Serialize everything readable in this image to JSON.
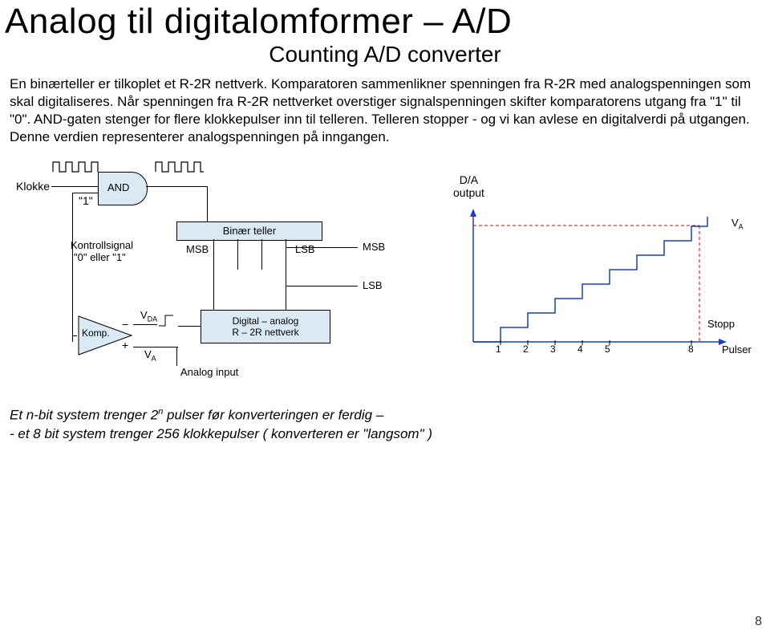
{
  "title": "Analog til digitalomformer – A/D",
  "subtitle": "Counting A/D converter",
  "paragraph": "En binærteller er tilkoplet et R-2R nettverk.\nKomparatoren sammenlikner spenningen fra R-2R med analogspenningen som skal digitaliseres. Når spenningen fra R-2R nettverket overstiger signalspenningen skifter komparatorens utgang fra \"1\" til \"0\". AND-gaten stenger for flere klokkepulser inn til telleren. Telleren stopper - og vi kan avlese en digitalverdi på utgangen. Denne verdien representerer analogspenningen på inngangen.",
  "labels": {
    "klokke": "Klokke",
    "and": "AND",
    "one": "\"1\"",
    "binaer_teller": "Binær teller",
    "kontrollsignal": "Kontrollsignal",
    "kontrollsignal2": "\"0\" eller \"1\"",
    "msb": "MSB",
    "lsb": "LSB",
    "msb2": "MSB",
    "lsb2": "LSB",
    "komp": "Komp.",
    "vda": "V",
    "vda_sub": "DA",
    "va": "V",
    "va_sub": "A",
    "va2": "V",
    "va2_sub": "A",
    "digital_analog": "Digital – analog",
    "r2r": "R – 2R nettverk",
    "analog_input": "Analog input",
    "da_output": "D/A",
    "output": "output",
    "stopp": "Stopp",
    "pulser": "Pulser",
    "minus": "−",
    "plus": "+",
    "ticks": [
      "1",
      "2",
      "3",
      "4",
      "5",
      "",
      "",
      "8"
    ]
  },
  "footer_line1": "Et n-bit system trenger 2",
  "footer_sup": "n",
  "footer_line1b": " pulser før konverteringen er ferdig –",
  "footer_line2": "- et 8 bit system trenger 256 klokkepulser ( konverteren er \"langsom\" )",
  "page": "8"
}
